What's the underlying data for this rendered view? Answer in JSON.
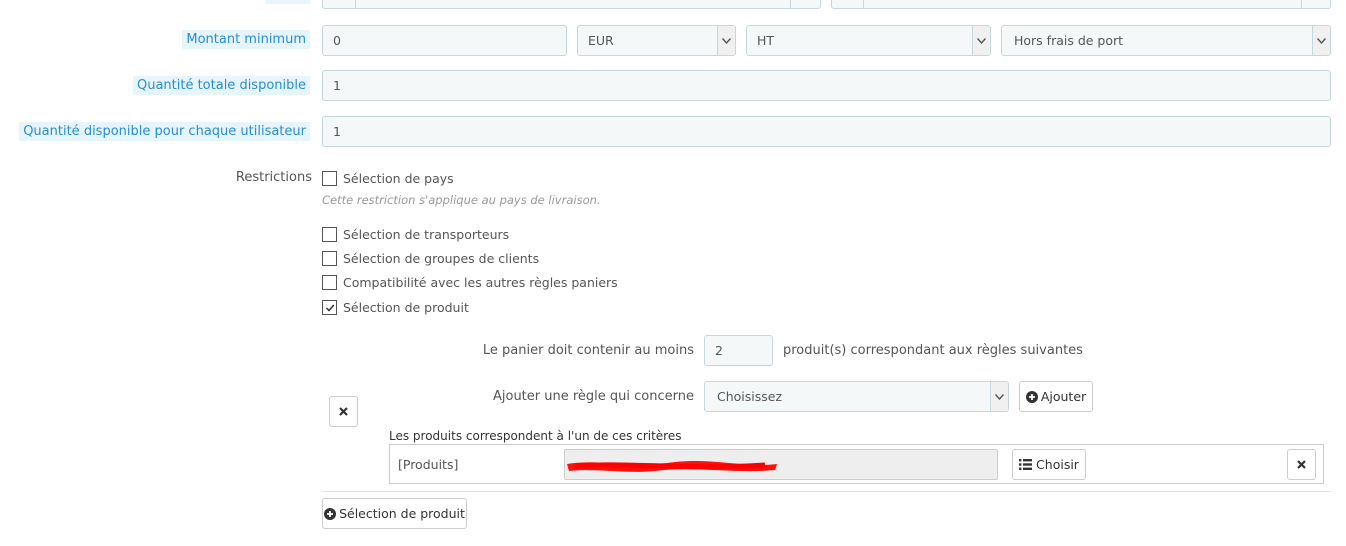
{
  "form": {
    "amount": {
      "label": "Montant minimum",
      "value": "0",
      "currency": "EUR",
      "tax": "HT",
      "shipping": "Hors frais de port"
    },
    "total_quantity": {
      "label": "Quantité totale disponible",
      "value": "1"
    },
    "per_user_quantity": {
      "label": "Quantité disponible pour chaque utilisateur",
      "value": "1"
    },
    "restrictions": {
      "label": "Restrictions",
      "options": [
        {
          "label": "Sélection de pays",
          "checked": false
        },
        {
          "label": "Sélection de transporteurs",
          "checked": false
        },
        {
          "label": "Sélection de groupes de clients",
          "checked": false
        },
        {
          "label": "Compatibilité avec les autres règles paniers",
          "checked": false
        },
        {
          "label": "Sélection de produit",
          "checked": true
        }
      ],
      "country_help": "Cette restriction s'applique au pays de livraison."
    },
    "product_rules": {
      "min_label": "Le panier doit contenir au moins",
      "min_value": "2",
      "min_suffix": "produit(s) correspondant aux règles suivantes",
      "add_rule_label": "Ajouter une règle qui concerne",
      "add_rule_select": "Choisissez",
      "add_button": "Ajouter",
      "group_title": "Les produits correspondent à l'un de ces critères",
      "rule_type": "[Produits]",
      "choose_button": "Choisir",
      "add_group_button": "Sélection de produit"
    }
  },
  "colors": {
    "accent": "#2a8ecb",
    "highlight_bg": "#e6f4fb",
    "field_bg": "#f5f8f9",
    "field_border": "#c7d6db",
    "redaction": "#ff0000"
  },
  "icons": [
    "chevron-down-icon",
    "check-icon",
    "close-icon",
    "plus-circle-icon",
    "list-icon"
  ]
}
